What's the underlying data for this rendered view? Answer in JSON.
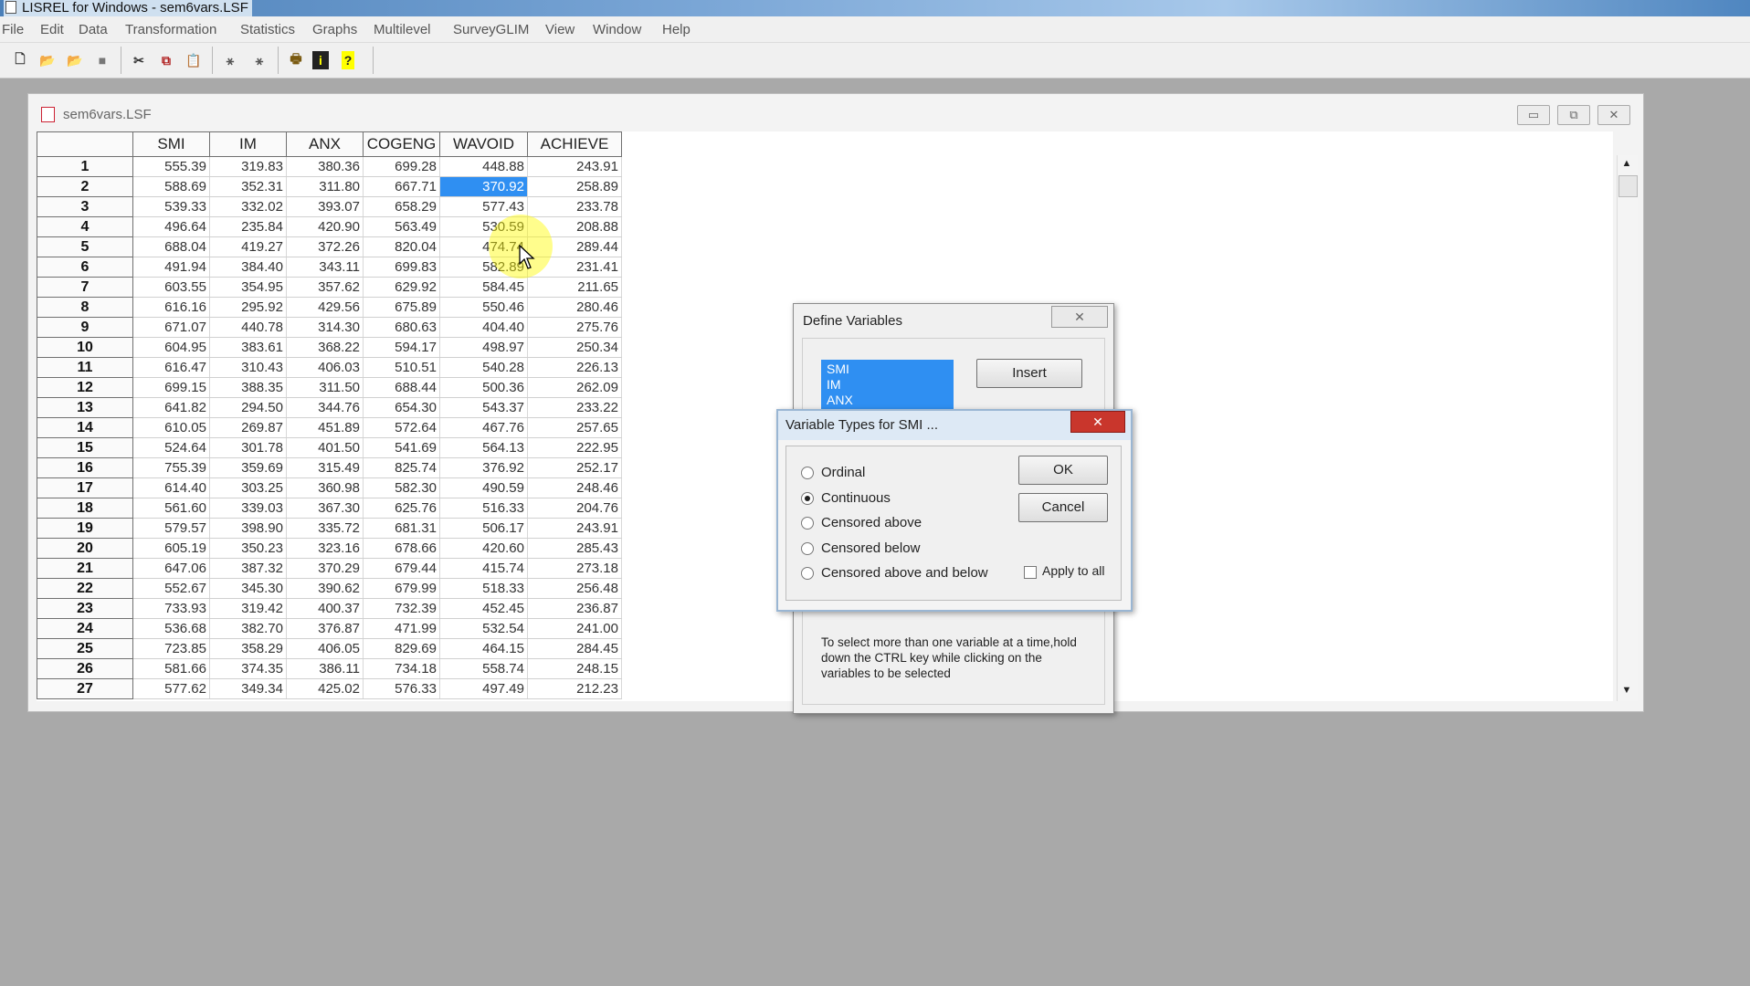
{
  "app": {
    "title": "LISREL for Windows - sem6vars.LSF"
  },
  "menu": [
    "File",
    "Edit",
    "Data",
    "Transformation",
    "Statistics",
    "Graphs",
    "Multilevel",
    "SurveyGLIM",
    "View",
    "Window",
    "Help"
  ],
  "toolbar": {
    "buttons": [
      {
        "name": "new-icon",
        "glyph": "🗋"
      },
      {
        "name": "open-icon",
        "glyph": "📂"
      },
      {
        "name": "open-data-icon",
        "glyph": "📂"
      },
      {
        "name": "save-icon",
        "glyph": "■"
      },
      {
        "name": "cut-icon",
        "glyph": "✂"
      },
      {
        "name": "copy-icon",
        "glyph": "⧉"
      },
      {
        "name": "paste-icon",
        "glyph": "📋"
      },
      {
        "name": "path-diagram-icon",
        "glyph": "⚹"
      },
      {
        "name": "path-diagram2-icon",
        "glyph": "⚹"
      },
      {
        "name": "print-icon",
        "glyph": "🖶"
      },
      {
        "name": "info-icon",
        "glyph": "i"
      },
      {
        "name": "help-icon",
        "glyph": "?"
      }
    ]
  },
  "doc": {
    "title": "sem6vars.LSF",
    "columns": [
      "SMI",
      "IM",
      "ANX",
      "COGENG",
      "WAVOID",
      "ACHIEVE"
    ],
    "rows": [
      [
        "1",
        "555.39",
        "319.83",
        "380.36",
        "699.28",
        "448.88",
        "243.91"
      ],
      [
        "2",
        "588.69",
        "352.31",
        "311.80",
        "667.71",
        "370.92",
        "258.89"
      ],
      [
        "3",
        "539.33",
        "332.02",
        "393.07",
        "658.29",
        "577.43",
        "233.78"
      ],
      [
        "4",
        "496.64",
        "235.84",
        "420.90",
        "563.49",
        "530.59",
        "208.88"
      ],
      [
        "5",
        "688.04",
        "419.27",
        "372.26",
        "820.04",
        "474.74",
        "289.44"
      ],
      [
        "6",
        "491.94",
        "384.40",
        "343.11",
        "699.83",
        "582.89",
        "231.41"
      ],
      [
        "7",
        "603.55",
        "354.95",
        "357.62",
        "629.92",
        "584.45",
        "211.65"
      ],
      [
        "8",
        "616.16",
        "295.92",
        "429.56",
        "675.89",
        "550.46",
        "280.46"
      ],
      [
        "9",
        "671.07",
        "440.78",
        "314.30",
        "680.63",
        "404.40",
        "275.76"
      ],
      [
        "10",
        "604.95",
        "383.61",
        "368.22",
        "594.17",
        "498.97",
        "250.34"
      ],
      [
        "11",
        "616.47",
        "310.43",
        "406.03",
        "510.51",
        "540.28",
        "226.13"
      ],
      [
        "12",
        "699.15",
        "388.35",
        "311.50",
        "688.44",
        "500.36",
        "262.09"
      ],
      [
        "13",
        "641.82",
        "294.50",
        "344.76",
        "654.30",
        "543.37",
        "233.22"
      ],
      [
        "14",
        "610.05",
        "269.87",
        "451.89",
        "572.64",
        "467.76",
        "257.65"
      ],
      [
        "15",
        "524.64",
        "301.78",
        "401.50",
        "541.69",
        "564.13",
        "222.95"
      ],
      [
        "16",
        "755.39",
        "359.69",
        "315.49",
        "825.74",
        "376.92",
        "252.17"
      ],
      [
        "17",
        "614.40",
        "303.25",
        "360.98",
        "582.30",
        "490.59",
        "248.46"
      ],
      [
        "18",
        "561.60",
        "339.03",
        "367.30",
        "625.76",
        "516.33",
        "204.76"
      ],
      [
        "19",
        "579.57",
        "398.90",
        "335.72",
        "681.31",
        "506.17",
        "243.91"
      ],
      [
        "20",
        "605.19",
        "350.23",
        "323.16",
        "678.66",
        "420.60",
        "285.43"
      ],
      [
        "21",
        "647.06",
        "387.32",
        "370.29",
        "679.44",
        "415.74",
        "273.18"
      ],
      [
        "22",
        "552.67",
        "345.30",
        "390.62",
        "679.99",
        "518.33",
        "256.48"
      ],
      [
        "23",
        "733.93",
        "319.42",
        "400.37",
        "732.39",
        "452.45",
        "236.87"
      ],
      [
        "24",
        "536.68",
        "382.70",
        "376.87",
        "471.99",
        "532.54",
        "241.00"
      ],
      [
        "25",
        "723.85",
        "358.29",
        "406.05",
        "829.69",
        "464.15",
        "284.45"
      ],
      [
        "26",
        "581.66",
        "374.35",
        "386.11",
        "734.18",
        "558.74",
        "248.15"
      ],
      [
        "27",
        "577.62",
        "349.34",
        "425.02",
        "576.33",
        "497.49",
        "212.23"
      ]
    ]
  },
  "define_variables": {
    "title": "Define Variables",
    "list": [
      "SMI",
      "IM",
      "ANX"
    ],
    "insert_label": "Insert",
    "hint": "To select more than one variable at a time,hold down the CTRL key while clicking on the variables to be selected"
  },
  "variable_types": {
    "title": "Variable Types for SMI ...",
    "options": [
      "Ordinal",
      "Continuous",
      "Censored above",
      "Censored below",
      "Censored above and below"
    ],
    "selected": "Continuous",
    "ok_label": "OK",
    "cancel_label": "Cancel",
    "apply_all_label": "Apply to all"
  },
  "colors": {
    "selection": "#2f8ff2",
    "close_red": "#c9362c"
  }
}
